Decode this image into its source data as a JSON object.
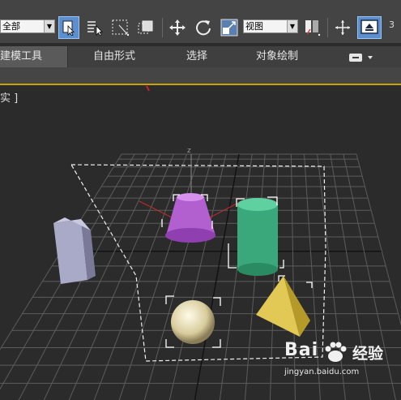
{
  "toolbar": {
    "selection_filter": "全部",
    "view_select": "视图",
    "trailing_number": "3",
    "tools": [
      {
        "icon": "select-object-icon",
        "active": true
      },
      {
        "icon": "select-by-name-icon",
        "active": false
      },
      {
        "icon": "rectangular-selection-region-icon",
        "active": false
      },
      {
        "icon": "window-crossing-icon",
        "active": false
      },
      {
        "icon": "move-icon",
        "active": false
      },
      {
        "icon": "rotate-icon",
        "active": false
      },
      {
        "icon": "scale-icon",
        "active": false
      },
      {
        "icon": "mirror-icon",
        "active": false
      },
      {
        "icon": "snap-icon",
        "active": false
      },
      {
        "icon": "manipulate-icon",
        "active": true
      }
    ]
  },
  "ribbon": {
    "tabs": [
      "建模工具",
      "自由形式",
      "选择",
      "对象绘制"
    ],
    "active_tab": "建模工具"
  },
  "viewport": {
    "label": "实 ]"
  },
  "watermark": {
    "brand": "Bai",
    "brand_suffix": "经验",
    "url": "jingyan.baidu.com"
  },
  "colors": {
    "toolbar_bg": "#444444",
    "viewport_bg": "#2b2b2b",
    "active_blue": "#5b8fd0",
    "ribbon_accent": "#c9a400",
    "cone": "#b25fd0",
    "cylinder": "#3aa87a",
    "box": "#a9a9c8",
    "sphere": "#e6dcb4",
    "pyramid": "#d9c04a",
    "annotation_arrow": "#cc1f1f"
  }
}
